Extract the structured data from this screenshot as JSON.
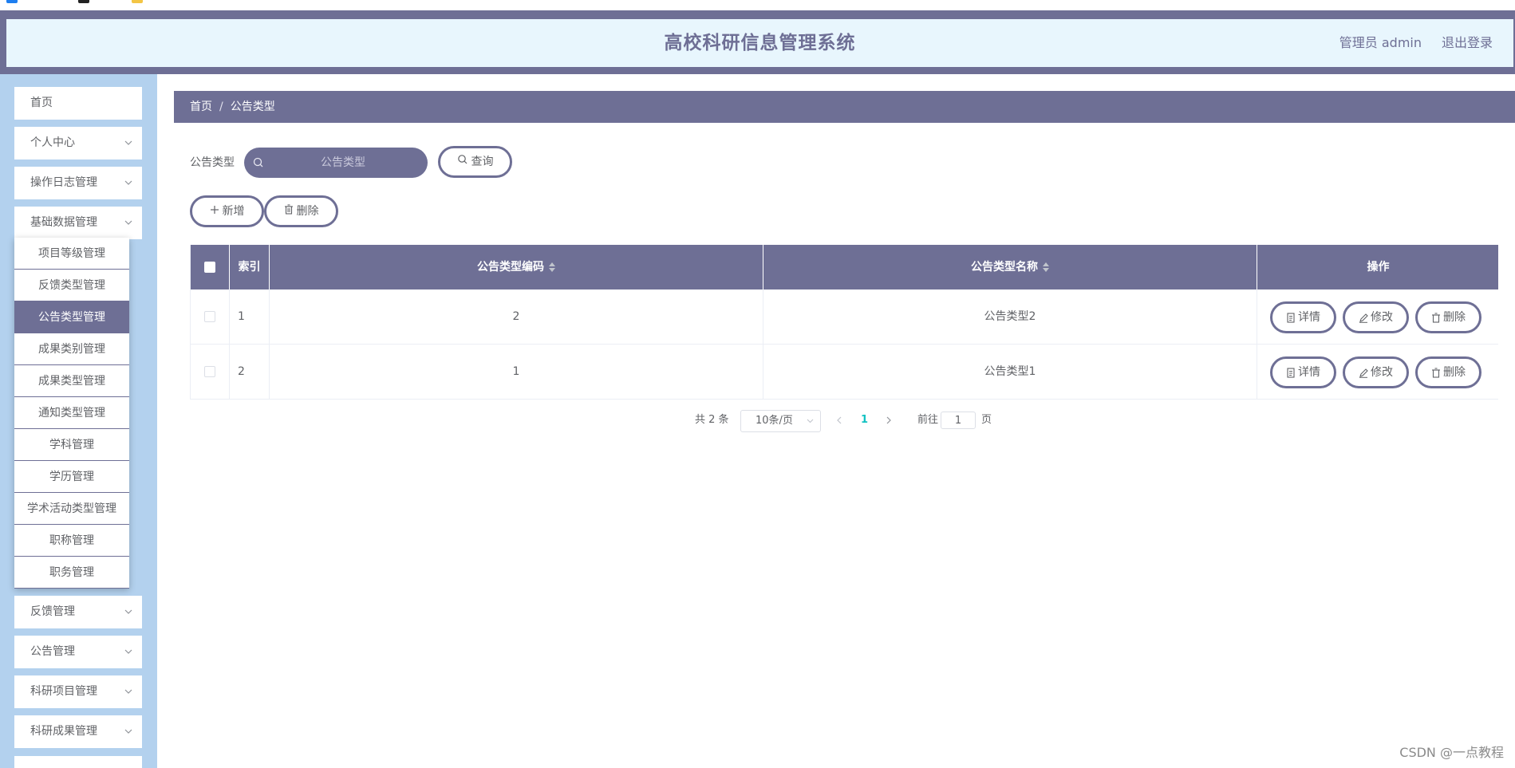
{
  "header": {
    "title": "高校科研信息管理系统",
    "user": "管理员 admin",
    "logout": "退出登录"
  },
  "sidebar": {
    "items": [
      {
        "label": "首页",
        "has_children": false
      },
      {
        "label": "个人中心",
        "has_children": true
      },
      {
        "label": "操作日志管理",
        "has_children": true
      },
      {
        "label": "基础数据管理",
        "has_children": true,
        "expanded": true
      }
    ],
    "submenu": [
      {
        "label": "项目等级管理"
      },
      {
        "label": "反馈类型管理"
      },
      {
        "label": "公告类型管理",
        "active": true
      },
      {
        "label": "成果类别管理"
      },
      {
        "label": "成果类型管理"
      },
      {
        "label": "通知类型管理"
      },
      {
        "label": "学科管理"
      },
      {
        "label": "学历管理"
      },
      {
        "label": "学术活动类型管理"
      },
      {
        "label": "职称管理"
      },
      {
        "label": "职务管理"
      }
    ],
    "items_after": [
      {
        "label": "反馈管理"
      },
      {
        "label": "公告管理"
      },
      {
        "label": "科研项目管理"
      },
      {
        "label": "科研成果管理"
      }
    ]
  },
  "breadcrumb": {
    "home": "首页",
    "separator": "/",
    "current": "公告类型"
  },
  "search": {
    "label": "公告类型",
    "placeholder": "公告类型",
    "query_button": "查询"
  },
  "toolbar": {
    "add_button": "新增",
    "delete_button": "删除"
  },
  "table": {
    "columns": [
      "索引",
      "公告类型编码",
      "公告类型名称",
      "操作"
    ],
    "rows": [
      {
        "index": "1",
        "code": "2",
        "name": "公告类型2"
      },
      {
        "index": "2",
        "code": "1",
        "name": "公告类型1"
      }
    ],
    "actions": {
      "detail": "详情",
      "edit": "修改",
      "delete": "删除"
    }
  },
  "pagination": {
    "total": "共 2 条",
    "page_size": "10条/页",
    "current_page": "1",
    "goto_label": "前往",
    "goto_value": "1",
    "goto_unit": "页"
  },
  "watermark": "CSDN @一点教程",
  "colors": {
    "primary": "#6e6f95",
    "header_bg": "#e8f6fd",
    "sidebar_bg": "#b3d1ee",
    "active_page": "#13c2c2"
  }
}
